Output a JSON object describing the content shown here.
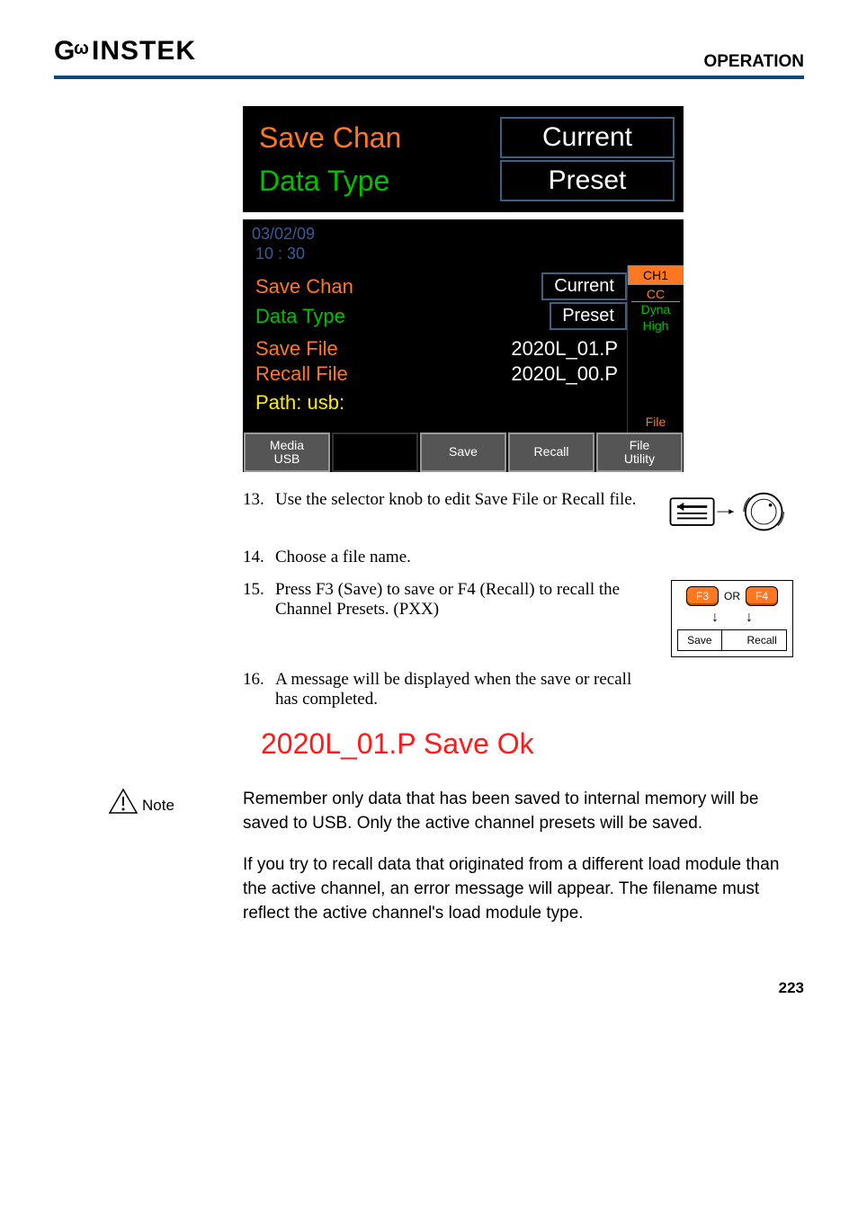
{
  "header": {
    "brand_text": "GWINSTEK",
    "section": "OPERATION"
  },
  "screen_big": {
    "row1_label": "Save Chan",
    "row1_value": "Current",
    "row2_label": "Data Type",
    "row2_value": "Preset"
  },
  "screen_full": {
    "date": "03/02/09",
    "time": "10 : 30",
    "rows": {
      "save_chan_label": "Save Chan",
      "save_chan_value": "Current",
      "data_type_label": "Data Type",
      "data_type_value": "Preset",
      "save_file_label": "Save File",
      "save_file_value": "2020L_01.P",
      "recall_file_label": "Recall File",
      "recall_file_value": "2020L_00.P",
      "path_label": "Path:  usb:"
    },
    "side": {
      "ch": "CH1",
      "cc": "CC",
      "dyna": "Dyna",
      "high": "High",
      "file": "File"
    },
    "fkeys": {
      "f1a": "Media",
      "f1b": "USB",
      "f3": "Save",
      "f4": "Recall",
      "f5a": "File",
      "f5b": "Utility"
    }
  },
  "steps": {
    "s13_num": "13.",
    "s13_txt": "Use the selector knob to edit Save File or Recall file.",
    "s14_num": "14.",
    "s14_txt": "Choose a file name.",
    "s15_num": "15.",
    "s15_txt": "Press F3 (Save) to save or F4 (Recall) to recall the Channel Presets. (PXX)",
    "s16_num": "16.",
    "s16_txt": "A message will be displayed when the save or recall has completed."
  },
  "btn_fig": {
    "f3": "F3",
    "or": "OR",
    "f4": "F4",
    "save": "Save",
    "recall": "Recall"
  },
  "result_message": "2020L_01.P Save Ok",
  "note": {
    "label": "Note",
    "p1": "Remember only data that has been saved to internal memory will be saved to USB. Only the active channel presets will be saved.",
    "p2": "If you try to recall data that originated from a different load module than the active channel, an error message will appear. The filename must reflect the active channel's load module type."
  },
  "page_number": "223"
}
